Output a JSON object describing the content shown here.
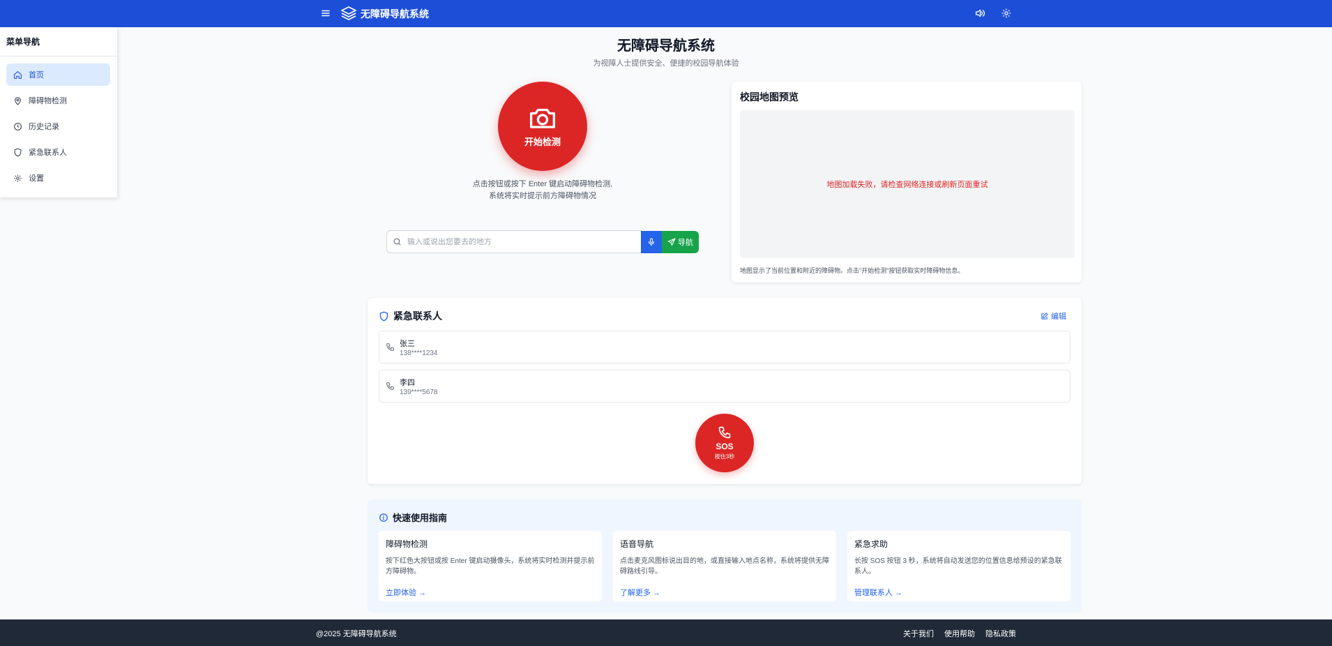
{
  "header": {
    "app_title": "无障碍导航系统"
  },
  "sidebar": {
    "title": "菜单导航",
    "items": [
      {
        "label": "首页",
        "icon": "home-icon",
        "active": true
      },
      {
        "label": "障碍物检测",
        "icon": "map-pin-icon",
        "active": false
      },
      {
        "label": "历史记录",
        "icon": "clock-icon",
        "active": false
      },
      {
        "label": "紧急联系人",
        "icon": "shield-icon",
        "active": false
      },
      {
        "label": "设置",
        "icon": "gear-icon",
        "active": false
      }
    ]
  },
  "hero": {
    "title": "无障碍导航系统",
    "subtitle": "为视障人士提供安全、便捷的校园导航体验"
  },
  "detect": {
    "button_label": "开始检测",
    "hint_line1": "点击按钮或按下 Enter 键启动障碍物检测,",
    "hint_line2": "系统将实时提示前方障碍物情况"
  },
  "search": {
    "placeholder": "输入或说出您要去的地方",
    "value": "",
    "nav_label": "导航"
  },
  "map": {
    "title": "校园地图预览",
    "error": "地图加载失败，请检查网络连接或刷新页面重试",
    "note": "地图显示了当前位置和附近的障碍物。点击\"开始检测\"按钮获取实时障碍物信息。"
  },
  "contacts": {
    "title": "紧急联系人",
    "edit_label": "编辑",
    "list": [
      {
        "name": "张三",
        "phone": "138****1234"
      },
      {
        "name": "李四",
        "phone": "139****5678"
      }
    ],
    "sos_label": "SOS",
    "sos_hint": "按住3秒"
  },
  "guide": {
    "title": "快速使用指南",
    "cards": [
      {
        "title": "障碍物检测",
        "desc": "按下红色大按钮或按 Enter 键启动摄像头，系统将实时检测并提示前方障碍物。",
        "link": "立即体验 →"
      },
      {
        "title": "语音导航",
        "desc": "点击麦克风图标说出目的地，或直接输入地点名称，系统将提供无障碍路线引导。",
        "link": "了解更多 →"
      },
      {
        "title": "紧急求助",
        "desc": "长按 SOS 按钮 3 秒，系统将自动发送您的位置信息给预设的紧急联系人。",
        "link": "管理联系人 →"
      }
    ]
  },
  "footer": {
    "copyright": "@2025 无障碍导航系统",
    "links": [
      "关于我们",
      "使用帮助",
      "隐私政策"
    ]
  },
  "colors": {
    "primary": "#1d4ed8",
    "danger": "#dc2626",
    "success": "#16a34a",
    "footer_bg": "#1f2937"
  }
}
